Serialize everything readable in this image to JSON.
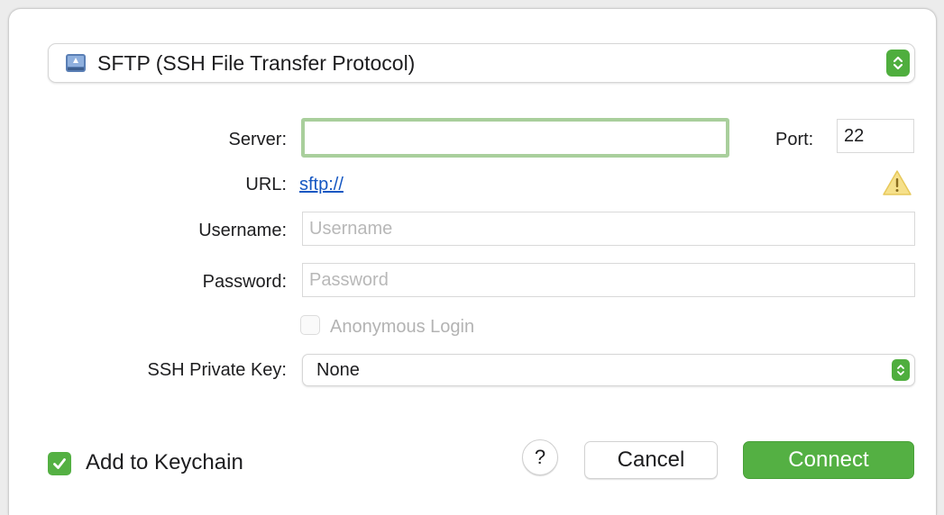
{
  "protocol": {
    "selected": "SFTP (SSH File Transfer Protocol)",
    "icon": "drive-icon"
  },
  "server": {
    "label": "Server:",
    "value": "",
    "placeholder": ""
  },
  "port": {
    "label": "Port:",
    "value": "22"
  },
  "url": {
    "label": "URL:",
    "value": "sftp://"
  },
  "username": {
    "label": "Username:",
    "value": "",
    "placeholder": "Username"
  },
  "password": {
    "label": "Password:",
    "value": "",
    "placeholder": "Password"
  },
  "anonymous": {
    "label": "Anonymous Login",
    "checked": false,
    "disabled": true
  },
  "ssh_key": {
    "label": "SSH Private Key:",
    "selected": "None"
  },
  "keychain": {
    "label": "Add to Keychain",
    "checked": true
  },
  "buttons": {
    "help": "?",
    "cancel": "Cancel",
    "connect": "Connect"
  },
  "colors": {
    "accent": "#54b043",
    "focus_ring": "#a9cf9c",
    "link": "#1557c2",
    "warning": "#f4d35e"
  }
}
